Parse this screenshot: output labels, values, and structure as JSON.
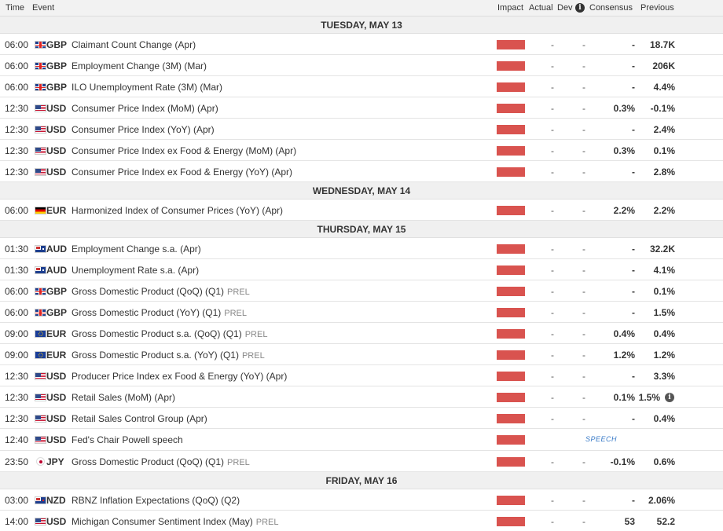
{
  "header": {
    "time": "Time",
    "event": "Event",
    "impact": "Impact",
    "actual": "Actual",
    "dev": "Dev",
    "consensus": "Consensus",
    "previous": "Previous"
  },
  "colors": {
    "impact_high": "#d9534f",
    "speech_text": "#3a7bc8"
  },
  "days": [
    {
      "label": "TUESDAY, MAY 13",
      "events": [
        {
          "time": "06:00",
          "flag": "gb",
          "currency": "GBP",
          "name": "Claimant Count Change (Apr)",
          "prel": "",
          "actual": "-",
          "dev": "-",
          "consensus": "-",
          "previous": "18.7K"
        },
        {
          "time": "06:00",
          "flag": "gb",
          "currency": "GBP",
          "name": "Employment Change (3M) (Mar)",
          "prel": "",
          "actual": "-",
          "dev": "-",
          "consensus": "-",
          "previous": "206K"
        },
        {
          "time": "06:00",
          "flag": "gb",
          "currency": "GBP",
          "name": "ILO Unemployment Rate (3M) (Mar)",
          "prel": "",
          "actual": "-",
          "dev": "-",
          "consensus": "-",
          "previous": "4.4%"
        },
        {
          "time": "12:30",
          "flag": "us",
          "currency": "USD",
          "name": "Consumer Price Index (MoM) (Apr)",
          "prel": "",
          "actual": "-",
          "dev": "-",
          "consensus": "0.3%",
          "previous": "-0.1%"
        },
        {
          "time": "12:30",
          "flag": "us",
          "currency": "USD",
          "name": "Consumer Price Index (YoY) (Apr)",
          "prel": "",
          "actual": "-",
          "dev": "-",
          "consensus": "-",
          "previous": "2.4%"
        },
        {
          "time": "12:30",
          "flag": "us",
          "currency": "USD",
          "name": "Consumer Price Index ex Food & Energy (MoM) (Apr)",
          "prel": "",
          "actual": "-",
          "dev": "-",
          "consensus": "0.3%",
          "previous": "0.1%"
        },
        {
          "time": "12:30",
          "flag": "us",
          "currency": "USD",
          "name": "Consumer Price Index ex Food & Energy (YoY) (Apr)",
          "prel": "",
          "actual": "-",
          "dev": "-",
          "consensus": "-",
          "previous": "2.8%"
        }
      ]
    },
    {
      "label": "WEDNESDAY, MAY 14",
      "events": [
        {
          "time": "06:00",
          "flag": "de",
          "currency": "EUR",
          "name": "Harmonized Index of Consumer Prices (YoY) (Apr)",
          "prel": "",
          "actual": "-",
          "dev": "-",
          "consensus": "2.2%",
          "previous": "2.2%"
        }
      ]
    },
    {
      "label": "THURSDAY, MAY 15",
      "events": [
        {
          "time": "01:30",
          "flag": "au",
          "currency": "AUD",
          "name": "Employment Change s.a. (Apr)",
          "prel": "",
          "actual": "-",
          "dev": "-",
          "consensus": "-",
          "previous": "32.2K"
        },
        {
          "time": "01:30",
          "flag": "au",
          "currency": "AUD",
          "name": "Unemployment Rate s.a. (Apr)",
          "prel": "",
          "actual": "-",
          "dev": "-",
          "consensus": "-",
          "previous": "4.1%"
        },
        {
          "time": "06:00",
          "flag": "gb",
          "currency": "GBP",
          "name": "Gross Domestic Product (QoQ) (Q1)",
          "prel": "PREL",
          "actual": "-",
          "dev": "-",
          "consensus": "-",
          "previous": "0.1%"
        },
        {
          "time": "06:00",
          "flag": "gb",
          "currency": "GBP",
          "name": "Gross Domestic Product (YoY) (Q1)",
          "prel": "PREL",
          "actual": "-",
          "dev": "-",
          "consensus": "-",
          "previous": "1.5%"
        },
        {
          "time": "09:00",
          "flag": "eu",
          "currency": "EUR",
          "name": "Gross Domestic Product s.a. (QoQ) (Q1)",
          "prel": "PREL",
          "actual": "-",
          "dev": "-",
          "consensus": "0.4%",
          "previous": "0.4%"
        },
        {
          "time": "09:00",
          "flag": "eu",
          "currency": "EUR",
          "name": "Gross Domestic Product s.a. (YoY) (Q1)",
          "prel": "PREL",
          "actual": "-",
          "dev": "-",
          "consensus": "1.2%",
          "previous": "1.2%"
        },
        {
          "time": "12:30",
          "flag": "us",
          "currency": "USD",
          "name": "Producer Price Index ex Food & Energy (YoY) (Apr)",
          "prel": "",
          "actual": "-",
          "dev": "-",
          "consensus": "-",
          "previous": "3.3%"
        },
        {
          "time": "12:30",
          "flag": "us",
          "currency": "USD",
          "name": "Retail Sales (MoM) (Apr)",
          "prel": "",
          "actual": "-",
          "dev": "-",
          "consensus": "0.1%",
          "previous": "1.5%",
          "previous_info": true
        },
        {
          "time": "12:30",
          "flag": "us",
          "currency": "USD",
          "name": "Retail Sales Control Group (Apr)",
          "prel": "",
          "actual": "-",
          "dev": "-",
          "consensus": "-",
          "previous": "0.4%"
        },
        {
          "time": "12:40",
          "flag": "us",
          "currency": "USD",
          "name": "Fed's Chair Powell speech",
          "prel": "",
          "speech": "SPEECH"
        },
        {
          "time": "23:50",
          "flag": "jp",
          "currency": "JPY",
          "name": "Gross Domestic Product (QoQ) (Q1)",
          "prel": "PREL",
          "actual": "-",
          "dev": "-",
          "consensus": "-0.1%",
          "previous": "0.6%"
        }
      ]
    },
    {
      "label": "FRIDAY, MAY 16",
      "events": [
        {
          "time": "03:00",
          "flag": "nz",
          "currency": "NZD",
          "name": "RBNZ Inflation Expectations (QoQ) (Q2)",
          "prel": "",
          "actual": "-",
          "dev": "-",
          "consensus": "-",
          "previous": "2.06%"
        },
        {
          "time": "14:00",
          "flag": "us",
          "currency": "USD",
          "name": "Michigan Consumer Sentiment Index (May)",
          "prel": "PREL",
          "actual": "-",
          "dev": "-",
          "consensus": "53",
          "previous": "52.2"
        }
      ]
    }
  ]
}
